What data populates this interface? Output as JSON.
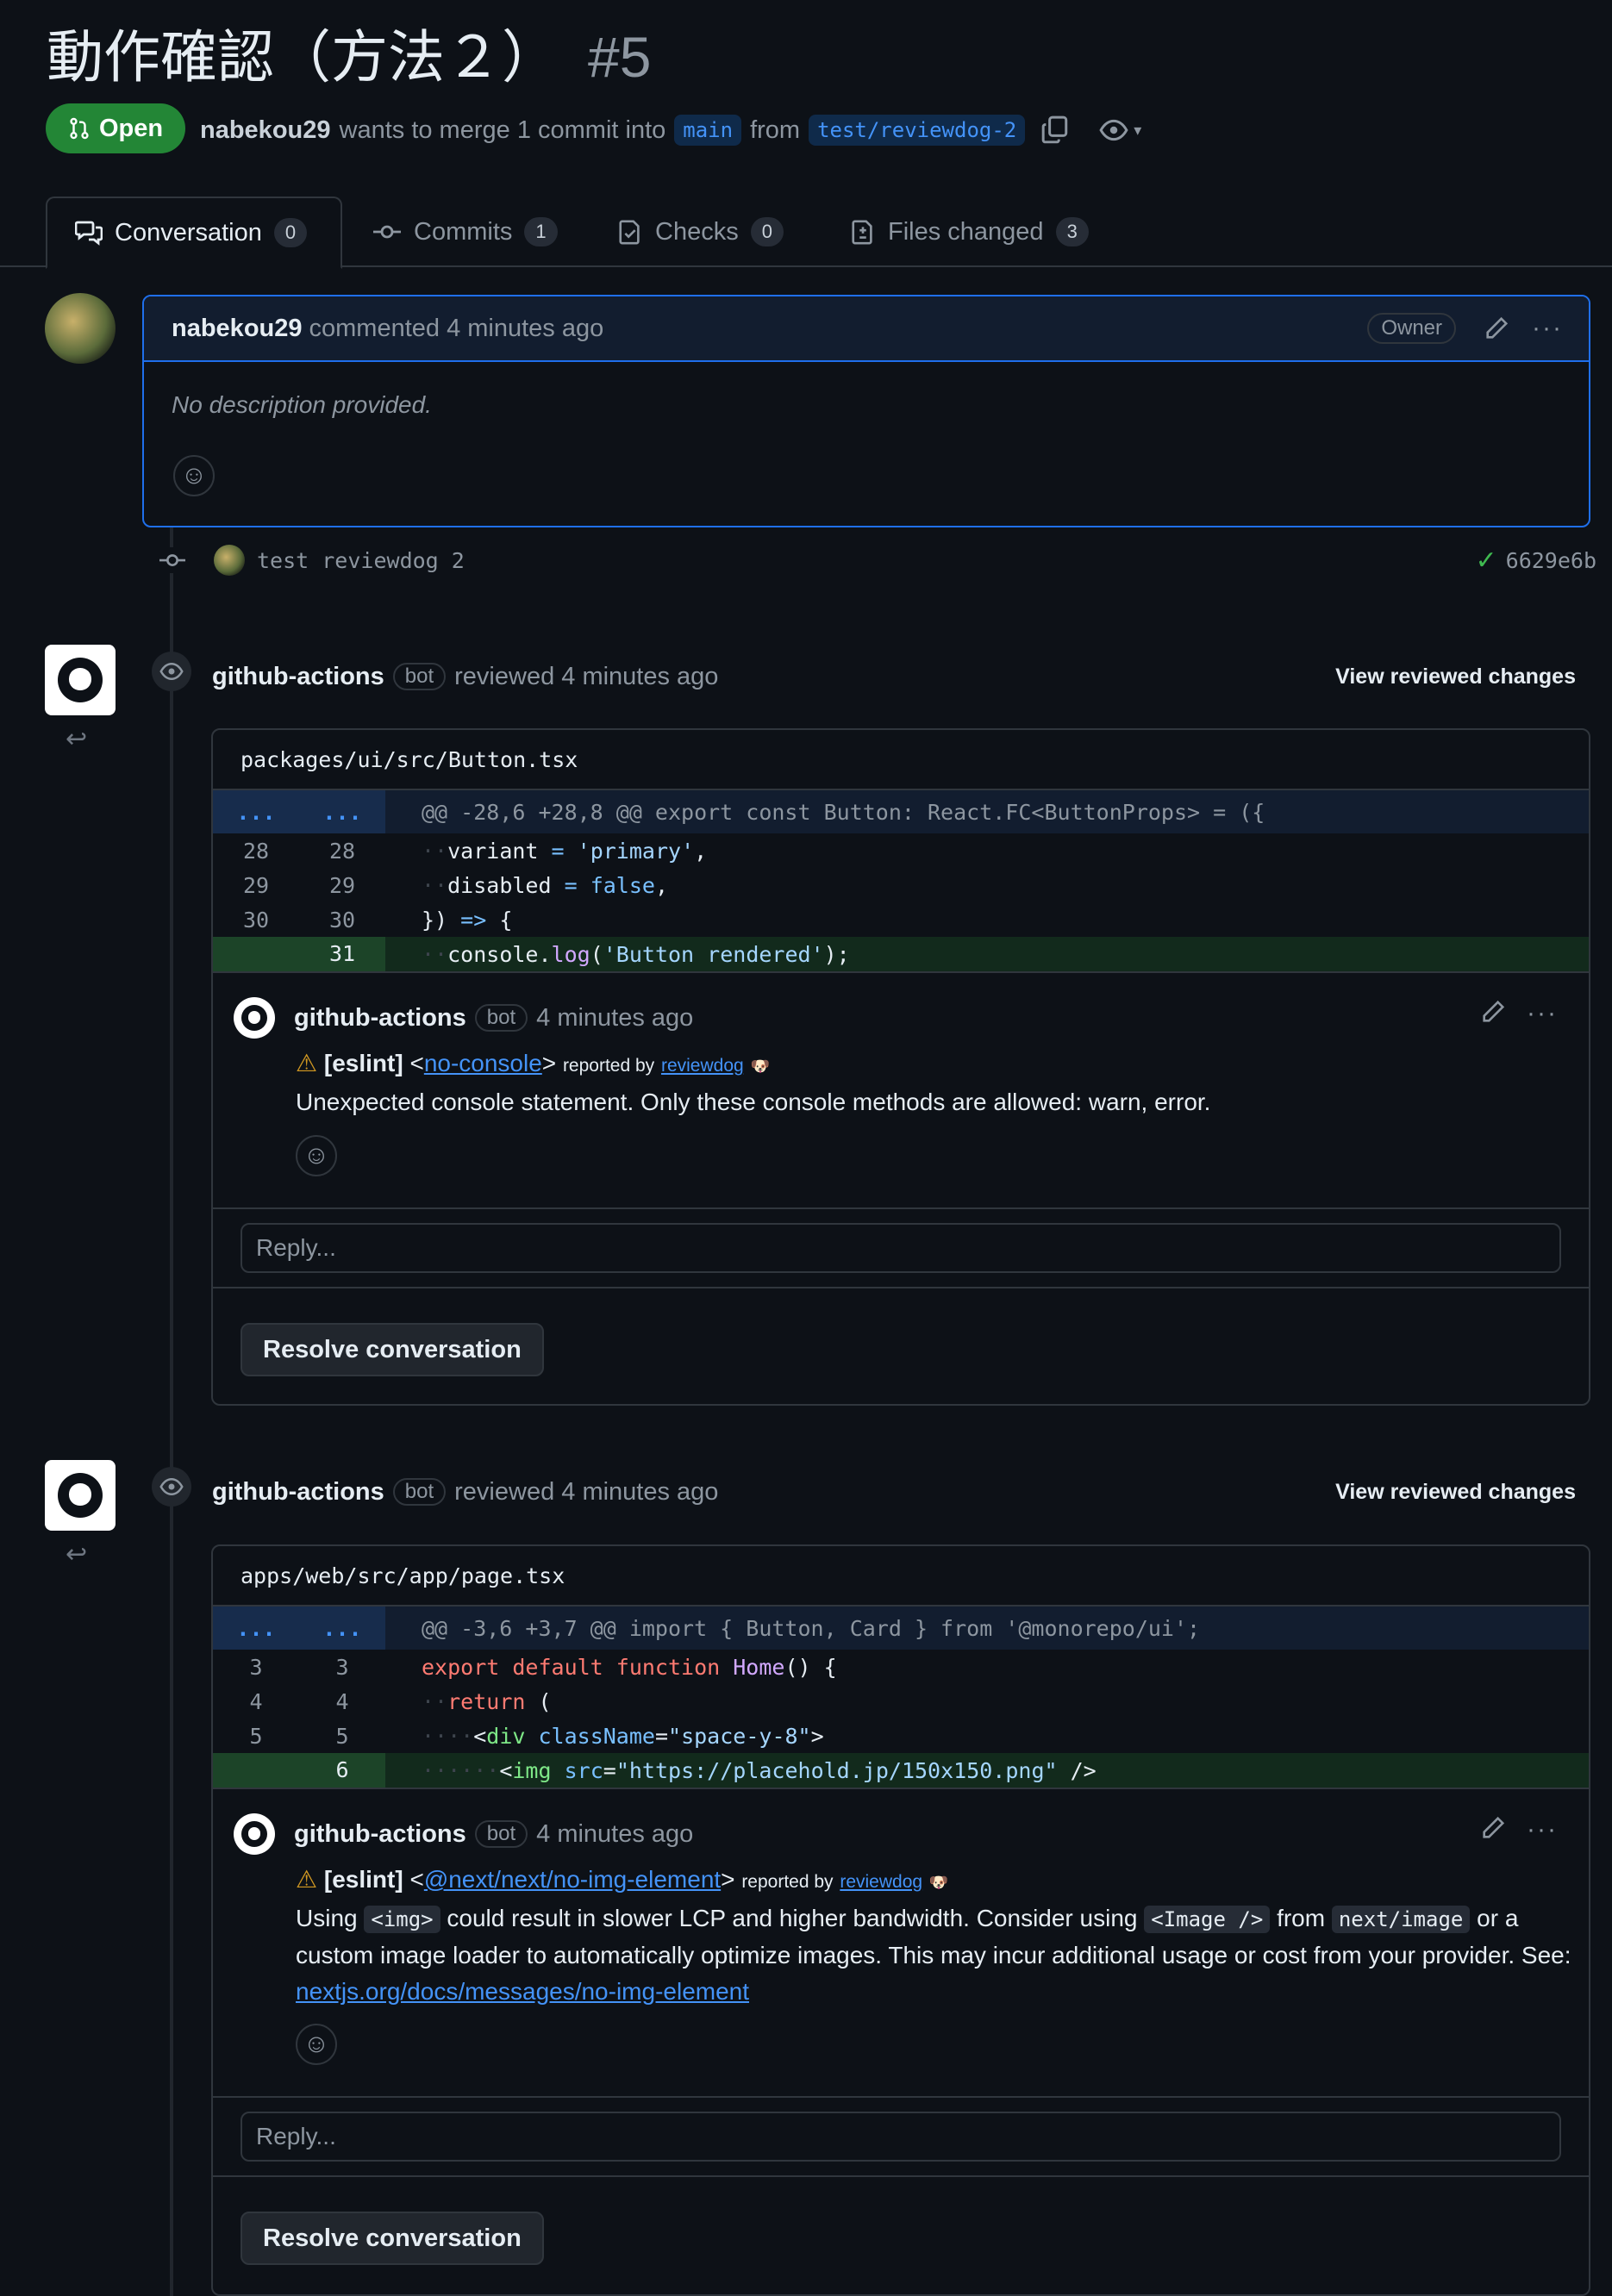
{
  "pr": {
    "title": "動作確認（方法２）",
    "number": "#5",
    "state": "Open",
    "author": "nabekou29",
    "merge_text": "wants to merge 1 commit into",
    "base": "main",
    "from_word": "from",
    "head": "test/reviewdog-2"
  },
  "tabs": [
    {
      "label": "Conversation",
      "count": "0"
    },
    {
      "label": "Commits",
      "count": "1"
    },
    {
      "label": "Checks",
      "count": "0"
    },
    {
      "label": "Files changed",
      "count": "3"
    }
  ],
  "description": {
    "author": "nabekou29",
    "action": "commented 4 minutes ago",
    "role": "Owner",
    "text": "No description provided."
  },
  "commit": {
    "message": "test reviewdog 2",
    "sha": "6629e6b"
  },
  "reviews": [
    {
      "author": "github-actions",
      "bot": "bot",
      "action": "reviewed 4 minutes ago",
      "view": "View reviewed changes",
      "file": "packages/ui/src/Button.tsx",
      "hunk_gutter": "...",
      "hunk": "@@ -28,6 +28,8 @@ export const Button: React.FC<ButtonProps> = ({",
      "lines": [
        {
          "a": "28",
          "b": "28"
        },
        {
          "a": "29",
          "b": "29"
        },
        {
          "a": "30",
          "b": "30"
        },
        {
          "a": "",
          "b": "31"
        }
      ],
      "comment": {
        "author": "github-actions",
        "bot": "bot",
        "time": "4 minutes ago",
        "tool": "[eslint]",
        "rule": "no-console",
        "reported": "reported by",
        "reviewdog": "reviewdog",
        "message": "Unexpected console statement. Only these console methods are allowed: warn, error."
      },
      "reply_placeholder": "Reply...",
      "resolve": "Resolve conversation"
    },
    {
      "author": "github-actions",
      "bot": "bot",
      "action": "reviewed 4 minutes ago",
      "view": "View reviewed changes",
      "file": "apps/web/src/app/page.tsx",
      "hunk_gutter": "...",
      "hunk": "@@ -3,6 +3,7 @@ import { Button, Card } from '@monorepo/ui';",
      "lines": [
        {
          "a": "3",
          "b": "3"
        },
        {
          "a": "4",
          "b": "4"
        },
        {
          "a": "5",
          "b": "5"
        },
        {
          "a": "",
          "b": "6"
        }
      ],
      "comment": {
        "author": "github-actions",
        "bot": "bot",
        "time": "4 minutes ago",
        "tool": "[eslint]",
        "rule": "@next/next/no-img-element",
        "reported": "reported by",
        "reviewdog": "reviewdog",
        "msg1": "Using",
        "code1": "<img>",
        "msg2": "could result in slower LCP and higher bandwidth. Consider using",
        "code2": "<Image />",
        "msg3": "from",
        "code3": "next/image",
        "msg4": "or a custom image loader to automatically optimize images. This may incur additional usage or cost from your provider. See:",
        "link": "nextjs.org/docs/messages/no-img-element"
      },
      "reply_placeholder": "Reply...",
      "resolve": "Resolve conversation"
    }
  ],
  "colors": {
    "bg": "#0d1117",
    "open": "#238636",
    "link": "#4493f8",
    "border": "#30363d",
    "added": "#122a1c"
  }
}
